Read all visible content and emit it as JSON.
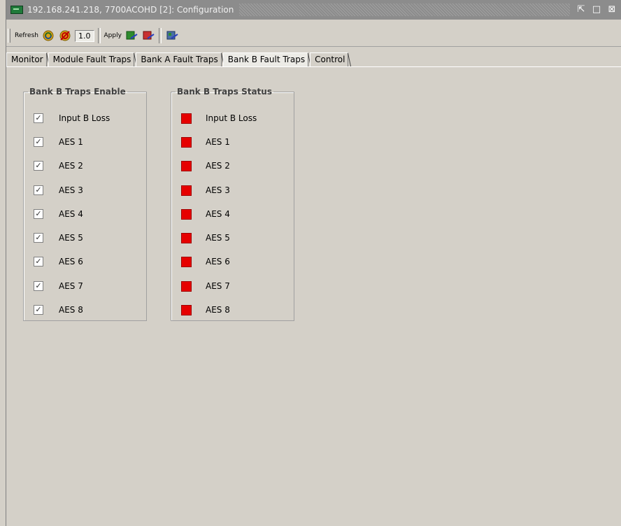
{
  "window": {
    "title": "192.168.241.218, 7700ACOHD  [2]: Configuration"
  },
  "toolbar": {
    "refresh_label": "Refresh",
    "version_value": "1.0",
    "apply_label": "Apply"
  },
  "tabs": [
    {
      "label": "Monitor",
      "active": false
    },
    {
      "label": "Module Fault Traps",
      "active": false
    },
    {
      "label": "Bank A Fault Traps",
      "active": false
    },
    {
      "label": "Bank B Fault Traps",
      "active": true
    },
    {
      "label": "Control",
      "active": false
    }
  ],
  "enable_panel": {
    "title": "Bank B Traps Enable",
    "items": [
      {
        "label": "Input B Loss",
        "checked": true
      },
      {
        "label": "AES 1",
        "checked": true
      },
      {
        "label": "AES 2",
        "checked": true
      },
      {
        "label": "AES 3",
        "checked": true
      },
      {
        "label": "AES 4",
        "checked": true
      },
      {
        "label": "AES 5",
        "checked": true
      },
      {
        "label": "AES 6",
        "checked": true
      },
      {
        "label": "AES 7",
        "checked": true
      },
      {
        "label": "AES 8",
        "checked": true
      }
    ]
  },
  "status_panel": {
    "title": "Bank B Traps Status",
    "status_color": "#e60000",
    "items": [
      {
        "label": "Input B Loss"
      },
      {
        "label": "AES 1"
      },
      {
        "label": "AES 2"
      },
      {
        "label": "AES 3"
      },
      {
        "label": "AES 4"
      },
      {
        "label": "AES 5"
      },
      {
        "label": "AES 6"
      },
      {
        "label": "AES 7"
      },
      {
        "label": "AES 8"
      }
    ]
  }
}
